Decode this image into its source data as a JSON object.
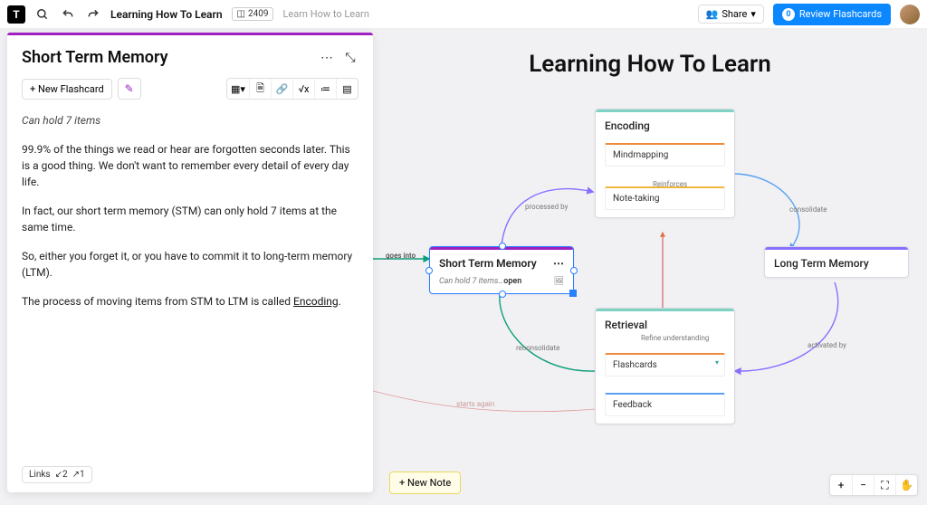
{
  "topbar": {
    "logo_letter": "T",
    "title": "Learning How To Learn",
    "counter_icon": "◫",
    "counter_value": "2409",
    "breadcrumb": "Learn How to Learn",
    "share_label": "Share",
    "share_caret": "▾",
    "review_badge": "0",
    "review_label": "Review Flashcards"
  },
  "panel": {
    "title": "Short Term Memory",
    "menu_icon": "⋯",
    "collapse_icon": "⤡",
    "new_flashcard": "+ New Flashcard",
    "wand_icon": "✎",
    "tools": {
      "add": "▦▾",
      "doc": "🗎",
      "link": "🔗",
      "fx": "√x",
      "list": "≔",
      "grid": "▤"
    },
    "subtitle": "Can hold 7 items",
    "para1": "99.9% of the things we read or hear are forgotten seconds later. This is a good thing. We don't want to remember every detail of every day life.",
    "para2": "In fact, our short term memory (STM) can only hold 7 items at the same time.",
    "para3": "So, either you forget it, or you have to commit it to long-term memory (LTM).",
    "para4_prefix": "The process of moving items from STM to LTM is called ",
    "para4_link": "Encoding",
    "para4_suffix": ".",
    "links_label": "Links",
    "links_in": "↙2",
    "links_out": "↗1"
  },
  "canvas": {
    "title": "Learning How To Learn",
    "stm": {
      "title": "Short Term Memory",
      "sub": "Can hold 7 items…",
      "open": "open",
      "menu": "⋯",
      "img_icon": "🖼",
      "accent": "#a020c0"
    },
    "ltm": {
      "title": "Long Term Memory",
      "accent": "#8a6fff"
    },
    "encoding": {
      "title": "Encoding",
      "accent": "#7fd3c4",
      "item1": "Mindmapping",
      "item1_accent": "#f08a3a",
      "item2": "Note-taking",
      "item2_accent": "#f0b83a",
      "rel": "Reinforces"
    },
    "retrieval": {
      "title": "Retrieval",
      "accent": "#7fd3c4",
      "sub": "Refine understanding",
      "item1": "Flashcards",
      "item1_accent": "#f08a3a",
      "item1_badge": "▾",
      "item2": "Feedback",
      "item2_accent": "#5aa0f0"
    },
    "edge_labels": {
      "goes_into": "goes into",
      "processed_by": "processed by",
      "consolidate": "consolidate",
      "activated_by": "activated by",
      "reconsolidate": "reconsolidate",
      "starts": "starts again"
    },
    "new_note": "+ New Note",
    "zoom": {
      "plus": "+",
      "minus": "−",
      "fit": "⛶",
      "hand": "✋"
    }
  }
}
